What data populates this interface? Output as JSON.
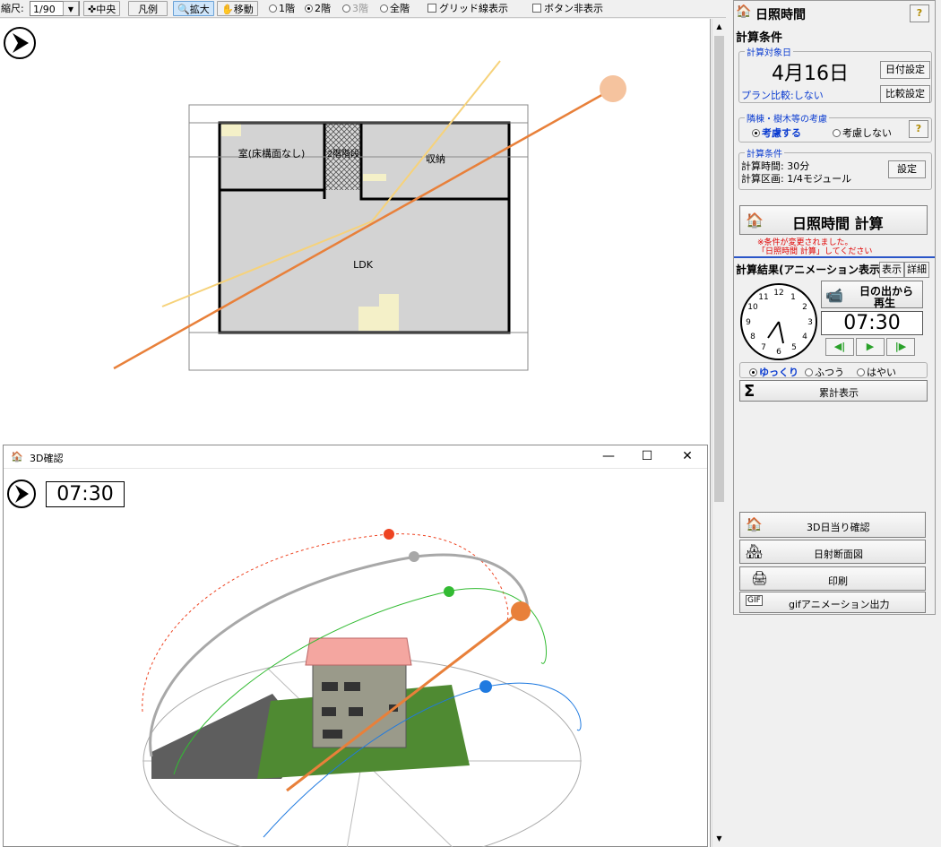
{
  "toolbar": {
    "scale_label": "縮尺:",
    "scale_value": "1/90",
    "center": "中央",
    "legend": "凡例",
    "zoom": "拡大",
    "move": "移動",
    "floor1": "1階",
    "floor2": "2階",
    "floor3": "3階",
    "floor_all": "全階",
    "grid": "グリッド線表示",
    "hide_buttons": "ボタン非表示"
  },
  "plan": {
    "rooms": [
      {
        "label": "室(床構面なし)"
      },
      {
        "label": "2階階段"
      },
      {
        "label": "収納"
      },
      {
        "label": "LDK"
      }
    ]
  },
  "window3d": {
    "title": "3D確認",
    "time": "07:30",
    "minimize": "—",
    "maximize": "☐",
    "close": "✕"
  },
  "panel": {
    "title": "日照時間",
    "help": "?",
    "calc_conditions": "計算条件",
    "target_date_label": "計算対象日",
    "date": "4月16日",
    "date_button": "日付設定",
    "plan_compare": "プラン比較:しない",
    "compare_button": "比較設定",
    "neighbor_label": "隣棟・樹木等の考慮",
    "consider": "考慮する",
    "not_consider": "考慮しない",
    "cond2_label": "計算条件",
    "calc_time": "計算時間:  30分",
    "calc_area": "計算区画:  1/4モジュール",
    "settings_button": "設定",
    "calc_button": "日照時間 計算",
    "warning_line1": "※条件が変更されました。",
    "warning_line2": "「日照時間 計算」してください",
    "result_title": "計算結果(アニメーション表示)",
    "display_button": "表示",
    "detail_button": "詳細",
    "play_line1": "日の出から",
    "play_line2": "再生",
    "time": "07:30",
    "speed_slow": "ゆっくり",
    "speed_normal": "ふつう",
    "speed_fast": "はやい",
    "cumulative": "累計表示",
    "btn_3d": "3D日当り確認",
    "btn_section": "日射断面図",
    "btn_print": "印刷",
    "btn_gif": "gifアニメーション出力"
  },
  "colors": {
    "sun_orange": "#e8803a",
    "sun_yellow": "#f6d27a",
    "path_red": "#ee4422",
    "path_gray": "#a8a8a8",
    "path_green": "#33bb33",
    "path_blue": "#1f7ae0",
    "room_gray": "#d3d3d3",
    "warning_red": "#e00000"
  }
}
